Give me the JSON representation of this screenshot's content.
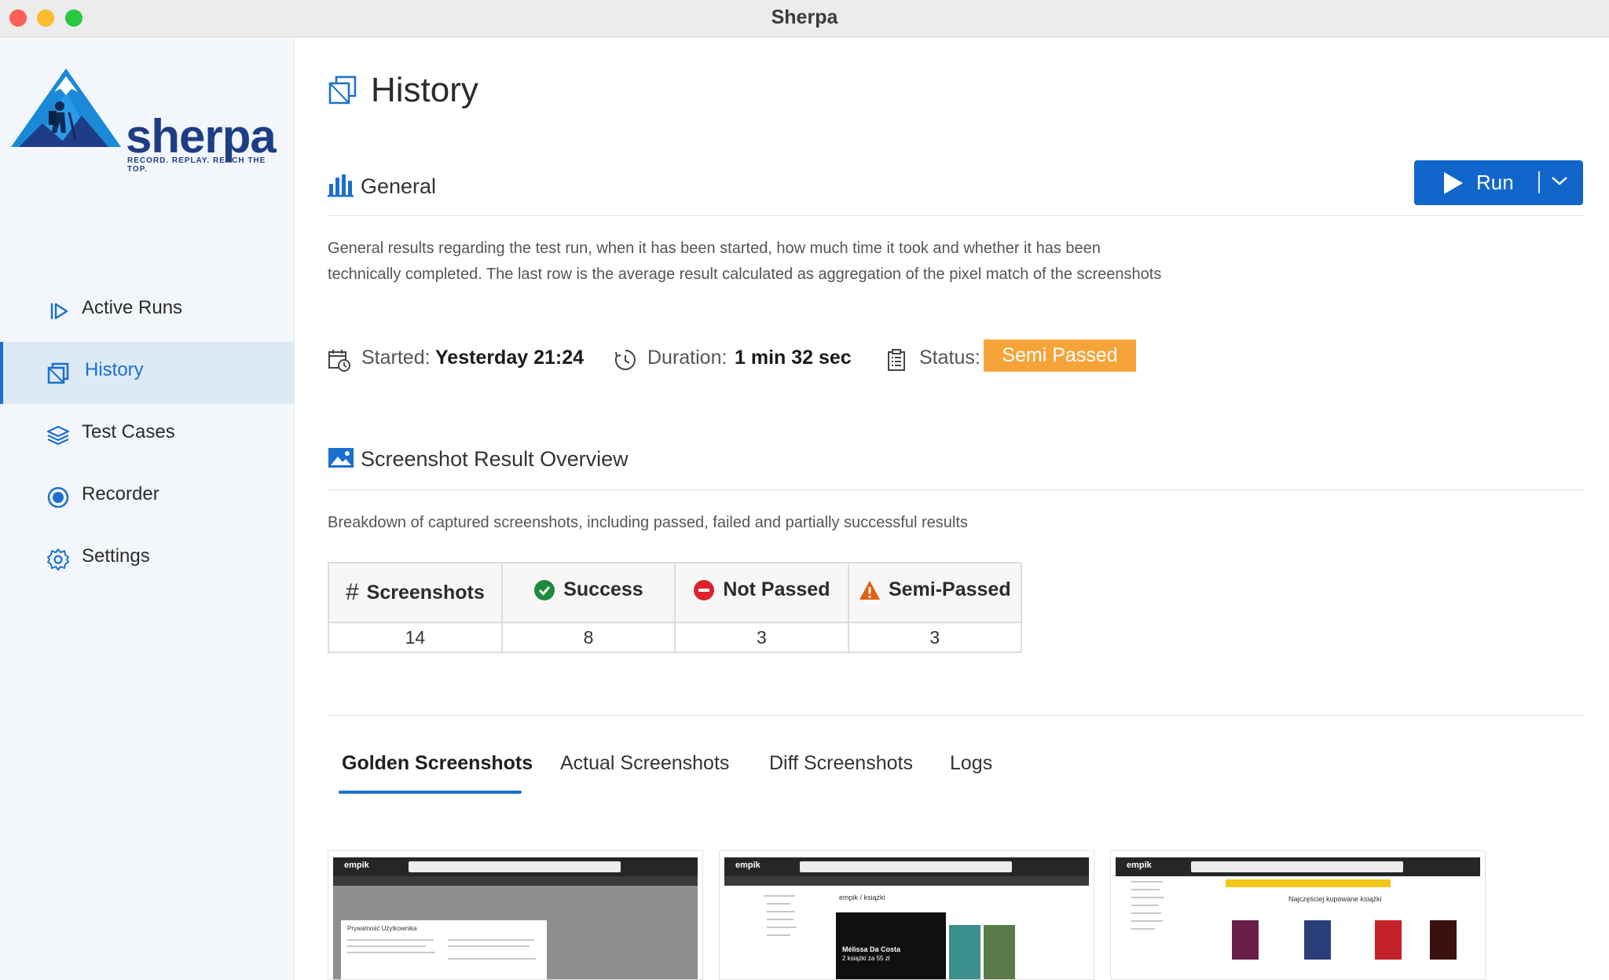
{
  "window": {
    "title": "Sherpa"
  },
  "logo": {
    "word": "sherpa",
    "tagline": "RECORD. REPLAY. REACH THE TOP."
  },
  "sidebar": {
    "items": [
      {
        "label": "Active Runs",
        "icon": "play-icon",
        "active": false
      },
      {
        "label": "History",
        "icon": "history-icon",
        "active": true
      },
      {
        "label": "Test Cases",
        "icon": "layers-icon",
        "active": false
      },
      {
        "label": "Recorder",
        "icon": "record-icon",
        "active": false
      },
      {
        "label": "Settings",
        "icon": "gear-icon",
        "active": false
      }
    ]
  },
  "page": {
    "title": "History"
  },
  "general": {
    "title": "General",
    "description": "General results regarding the test run, when it has been started, how much time it took and whether it has been technically completed. The last row is the average result calculated as aggregation of the pixel match of the screenshots",
    "started_label": "Started:",
    "started_value": "Yesterday 21:24",
    "duration_label": "Duration:",
    "duration_value": "1 min 32 sec",
    "status_label": "Status:",
    "status_value": "Semi Passed"
  },
  "run_button": {
    "label": "Run"
  },
  "overview": {
    "title": "Screenshot Result Overview",
    "description": "Breakdown of captured screenshots, including passed, failed and partially successful results",
    "columns": [
      "Screenshots",
      "Success",
      "Not Passed",
      "Semi-Passed"
    ],
    "values": [
      "14",
      "8",
      "3",
      "3"
    ]
  },
  "tabs": [
    {
      "label": "Golden Screenshots",
      "active": true
    },
    {
      "label": "Actual Screenshots",
      "active": false
    },
    {
      "label": "Diff Screenshots",
      "active": false
    },
    {
      "label": "Logs",
      "active": false
    }
  ],
  "thumbnails": {
    "brand": "empik",
    "privacy_title": "Prywatność Użytkownika",
    "books_breadcrumb": "empik / książki",
    "promo_author": "Mélissa Da Costa",
    "promo_offer": "2 książki za 55 zł",
    "bestsellers_title": "Najczęściej kupowane książki"
  },
  "colors": {
    "accent": "#1a6fd0",
    "run_button": "#1166cc",
    "status_badge": "#f5a43a",
    "success": "#1e8a3c",
    "not_passed": "#e0202e",
    "semi_passed": "#e06010"
  }
}
